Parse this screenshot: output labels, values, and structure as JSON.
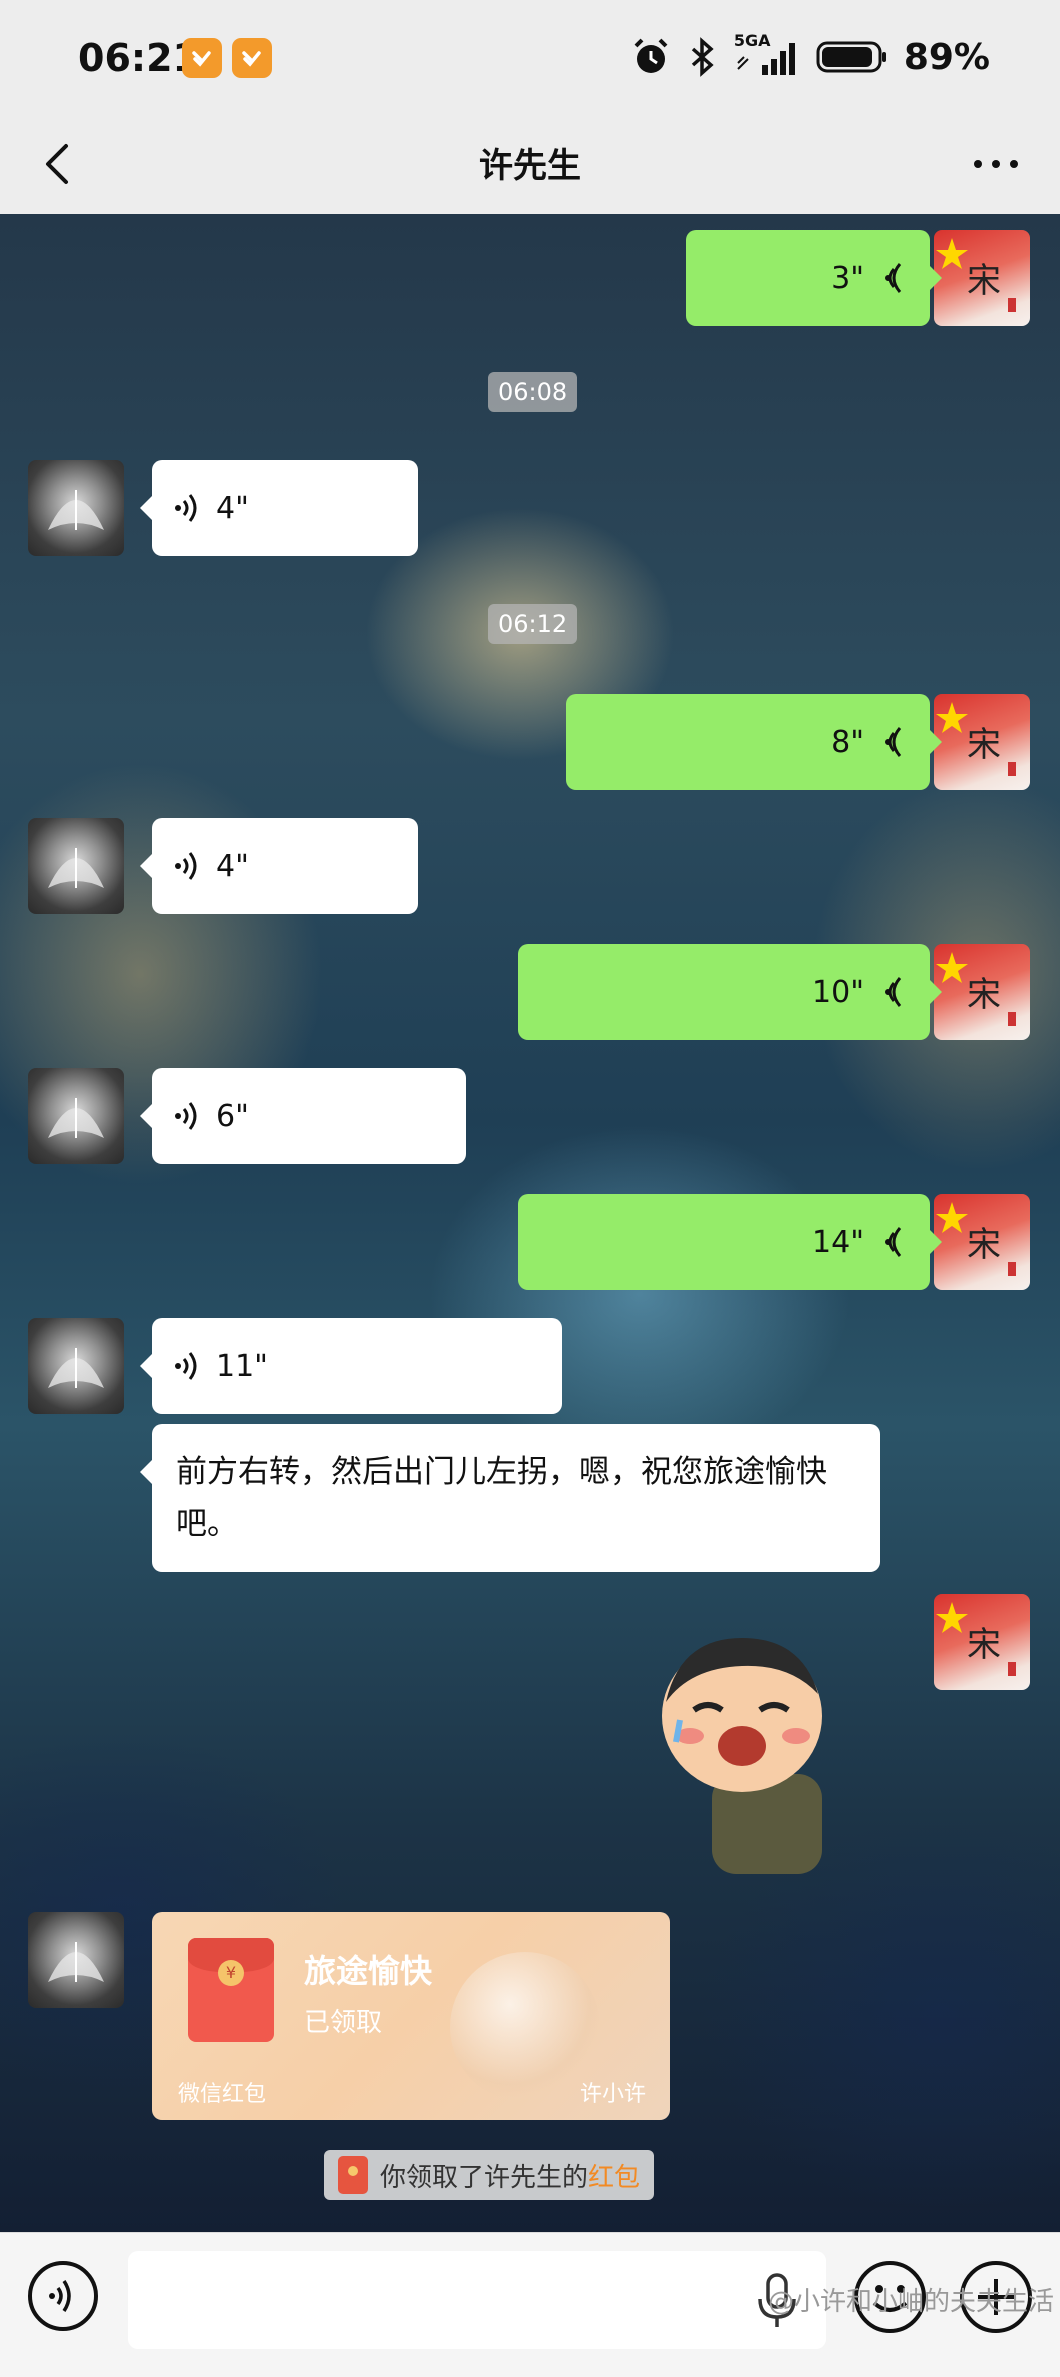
{
  "status_bar": {
    "time": "06:21",
    "network": "5GA",
    "battery": "89%"
  },
  "nav": {
    "title": "许先生"
  },
  "timestamps": [
    "06:08",
    "06:12"
  ],
  "messages": {
    "m1": {
      "duration": "3\""
    },
    "m2": {
      "duration": "4\""
    },
    "m3": {
      "duration": "8\""
    },
    "m4": {
      "duration": "4\""
    },
    "m5": {
      "duration": "10\""
    },
    "m6": {
      "duration": "6\""
    },
    "m7": {
      "duration": "14\""
    },
    "m8": {
      "duration": "11\""
    },
    "text": "前方右转，然后出门儿左拐，嗯，祝您旅途愉快吧。"
  },
  "avatar_me_label": "宋",
  "red_packet": {
    "title": "旅途愉快",
    "status": "已领取",
    "footer_left": "微信红包",
    "footer_right": "许小许"
  },
  "system_message": {
    "prefix": "你领取了许先生的",
    "link": "红包"
  },
  "watermark": "@小许和小岫的夫夫生活",
  "colors": {
    "outgoing_bubble": "#95ec69",
    "incoming_bubble": "#ffffff",
    "red_packet_link": "#f28a24"
  }
}
